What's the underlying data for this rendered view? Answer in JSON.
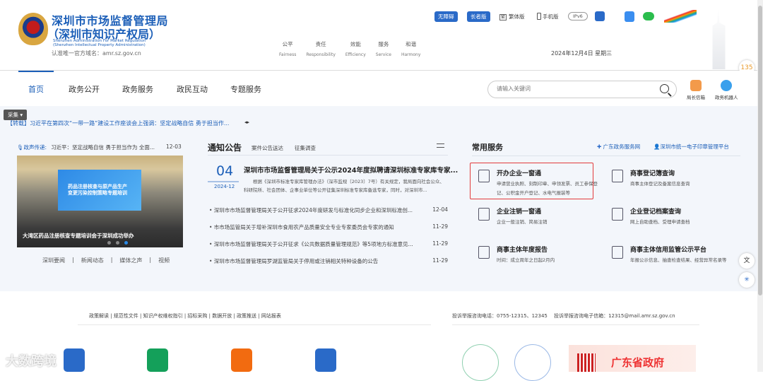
{
  "header": {
    "title_line1": "深圳市市场监督管理局",
    "title_line2": "（深圳市知识产权局）",
    "title_en_line1": "Shenzhen Administration For Market Regulation",
    "title_en_line2": "(Shenzhen Intellectual Property Administration)",
    "domain_note": "认准唯一官方域名：amr.sz.gov.cn",
    "values": [
      {
        "cn": "公平",
        "en": "Fairness"
      },
      {
        "cn": "责任",
        "en": "Responsibility"
      },
      {
        "cn": "效能",
        "en": "Efficiency"
      },
      {
        "cn": "服务",
        "en": "Service"
      },
      {
        "cn": "和谐",
        "en": "Harmony"
      }
    ],
    "accessibility": "无障碍",
    "elderly": "长者版",
    "traditional": "繁体版",
    "traditional_icon": "繁",
    "mobile": "手机版",
    "ipv6": "IPv6",
    "date": "2024年12月4日 星期三",
    "badge_135": "135"
  },
  "nav": {
    "items": [
      "首页",
      "政务公开",
      "政务服务",
      "政民互动",
      "专题服务"
    ],
    "search_placeholder": "请输入关键词",
    "quick": [
      "局长信箱",
      "政务机器人"
    ]
  },
  "collect": "采集 ▾",
  "ticker": {
    "text": "【转载】习近平在第四次“一带一路”建设工作座谈会上强调：坚定战略自信 勇于担当作...",
    "arrows": "◂▸"
  },
  "voice": {
    "label": "政声传递:",
    "text": "习近平：坚定战略自信 勇于担当作为 全面...",
    "date": "12-03"
  },
  "carousel": {
    "screen_text": "药品注册核查与原产品生产\n变更污染控制策略专题培训",
    "caption": "大湾区药品注册核查专题培训会于深圳成功举办",
    "active_dot": 3,
    "dot_count": 3
  },
  "news_tabs": [
    "深圳要闻",
    "新闻动态",
    "媒体之声",
    "视频"
  ],
  "notice": {
    "title": "通知公告",
    "tabs": [
      "案件公告送达",
      "征集调查"
    ],
    "featured": {
      "day": "04",
      "ym": "2024-12",
      "title": "深圳市市场监督管理局关于公示2024年度拟聘请深圳标准专家库专家...",
      "summary": "根据《深圳市标准专家库管理办法》（深市监规〔2023〕7号）有关规定，我局面向社会公众、科研院所、社会团体、企事业单位等公开征集深圳标准专家库备选专家，同时，对深圳市..."
    },
    "items": [
      {
        "title": "• 深圳市市场监督管理局关于公开征求2024年度研发与标准化同步企业和深圳标准创...",
        "date": "12-04"
      },
      {
        "title": "• 市市场监管局关于增补深圳市食用农产品质量安全专业专家委员会专家的通知",
        "date": "11-29"
      },
      {
        "title": "• 深圳市市场监督管理局关于公开征求《公共数据质量管理规范》等5项地方标准意见...",
        "date": "11-29"
      },
      {
        "title": "• 深圳市市场监督管理局罗湖监管局关于停用或注销相关特种设备的公告",
        "date": "11-29"
      }
    ]
  },
  "services": {
    "title": "常用服务",
    "links": [
      "广东政务服务网",
      "深圳市统一电子印章管理平台"
    ],
    "items": [
      {
        "title": "开办企业一窗通",
        "desc": "申请营业执照、刻制印章、申领发票、员工参保登记、公积金开户登记、水电气报装等"
      },
      {
        "title": "商事登记簿查询",
        "desc": "商事主体登记及备案信息查询"
      },
      {
        "title": "企业注销一窗通",
        "desc": "企业一般注销、简易注销"
      },
      {
        "title": "企业登记档案查询",
        "desc": "网上自助查档、受理申请查档"
      },
      {
        "title": "商事主体年度报告",
        "desc": "时间：成立周年之日起2月内"
      },
      {
        "title": "商事主体信用监管公示平台",
        "desc": "年报公示信息、抽查检查结果、经营异常名录等"
      }
    ]
  },
  "footer": {
    "links": "政策解读 | 规范性文件 | 知识产权维权指引 | 招标采购 | 数据开放 | 政策推送 | 网站报表",
    "contact": "投诉举报咨询电话：0755-12315、12345　 投诉举报咨询电子信箱：12315@mail.amr.sz.gov.cn",
    "gd_banner": "广东省政府",
    "watermark": "大数跨境"
  },
  "colors": {
    "brand": "#1c5fb8",
    "highlight": "#e23b3b",
    "bg": "#f3f6fb"
  }
}
